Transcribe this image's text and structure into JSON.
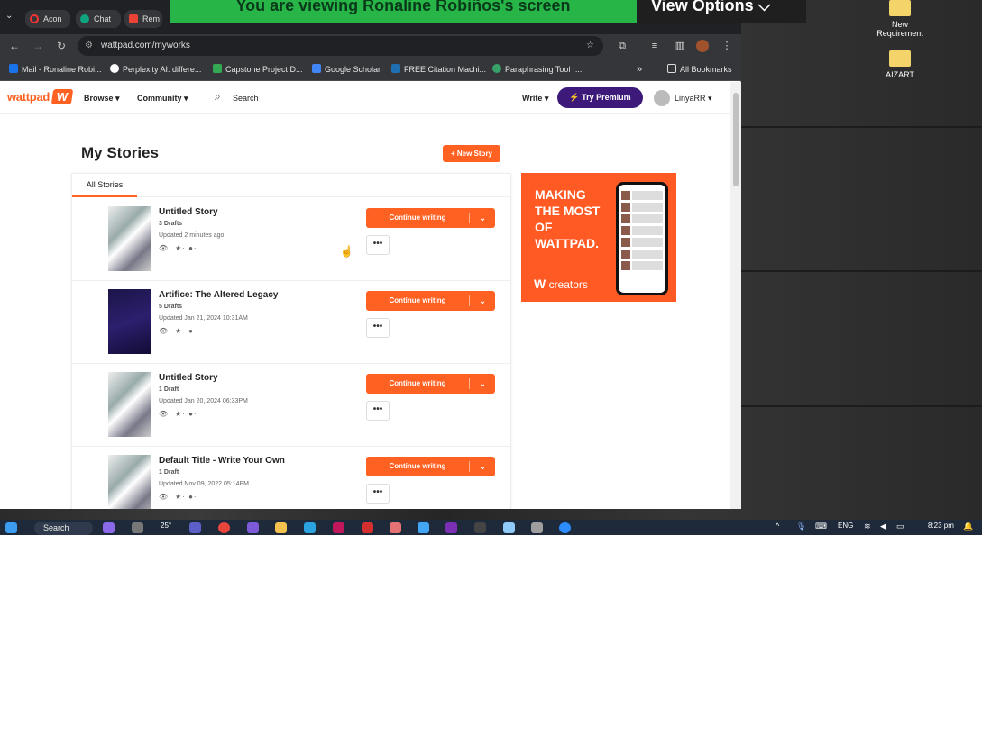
{
  "zoom": {
    "banner": "You are viewing  Ronaline Robiños's screen",
    "view_options": "View Options ⌵"
  },
  "desktop_icons": [
    {
      "label": "New Requirement"
    },
    {
      "label": "AIZART"
    }
  ],
  "browser": {
    "tabs": [
      {
        "label": "Acon",
        "color": "#ff3333"
      },
      {
        "label": "Chat",
        "color": "#10a37f"
      },
      {
        "label": "Rem",
        "color": "#ea4335"
      }
    ],
    "url": "wattpad.com/myworks",
    "bookmarks": [
      {
        "label": "Mail - Ronaline Robi...",
        "color": "#1a73e8"
      },
      {
        "label": "Perplexity AI: differe...",
        "color": "#ffffff"
      },
      {
        "label": "Capstone Project D...",
        "color": "#34a853"
      },
      {
        "label": "Google Scholar",
        "color": "#4285f4"
      },
      {
        "label": "FREE Citation Machi...",
        "color": "#1f6fb2"
      },
      {
        "label": "Paraphrasing Tool ·...",
        "color": "#38a169"
      }
    ],
    "all_bookmarks": "All Bookmarks"
  },
  "wattpad": {
    "logo": "wattpad",
    "logo_mark": "W",
    "nav": {
      "browse": "Browse ▾",
      "community": "Community ▾",
      "search": "Search",
      "write": "Write ▾",
      "premium": "⚡ Try Premium",
      "user": "LinyaRR ▾"
    },
    "page_title": "My Stories",
    "new_story": "+ New Story",
    "tab_all": "All Stories",
    "stories": [
      {
        "title": "Untitled Story",
        "drafts": "3 Drafts",
        "updated": "Updated 2 minutes ago",
        "stats": "👁·  ★·  ●·",
        "cover": "light"
      },
      {
        "title": "Artifice: The Altered Legacy",
        "drafts": "5 Drafts",
        "updated": "Updated Jan 21, 2024 10:31AM",
        "stats": "👁·  ★·  ●·",
        "cover": "dark"
      },
      {
        "title": "Untitled Story",
        "drafts": "1 Draft",
        "updated": "Updated Jan 20, 2024 06:33PM",
        "stats": "👁·  ★·  ●·",
        "cover": "light"
      },
      {
        "title": "Default Title - Write Your Own",
        "drafts": "1 Draft",
        "updated": "Updated Nov 09, 2022 05:14PM",
        "stats": "👁·  ★·  ●·",
        "cover": "light"
      }
    ],
    "continue_label": "Continue writing",
    "more_label": "•••",
    "ad": {
      "headline": "MAKING THE MOST OF WATTPAD.",
      "brand": "creators"
    }
  },
  "taskbar": {
    "search": "Search",
    "lang": "ENG",
    "time": "8:23 pm",
    "weather": "25°"
  }
}
